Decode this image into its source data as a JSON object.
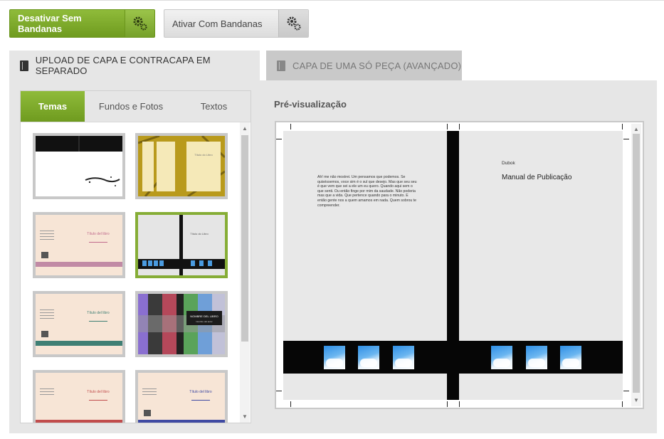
{
  "toggles": {
    "without": {
      "label": "Desativar Sem Bandanas",
      "icon": "gear-icon"
    },
    "with": {
      "label": "Ativar Com Bandanas",
      "icon": "gear-icon"
    }
  },
  "main_tabs": [
    {
      "label": "UPLOAD DE CAPA E CONTRACAPA EM SEPARADO",
      "icon": "book-icon",
      "active": true
    },
    {
      "label": "CAPA DE UMA SÓ PEÇA (AVANÇADO)",
      "icon": "book-icon",
      "active": false
    }
  ],
  "sub_tabs": [
    {
      "label": "Temas",
      "active": true
    },
    {
      "label": "Fundos e Fotos",
      "active": false
    },
    {
      "label": "Textos",
      "active": false
    }
  ],
  "themes": [
    {
      "name": "theme-1",
      "selected": false
    },
    {
      "name": "theme-2",
      "selected": false,
      "title": "Título do Libro"
    },
    {
      "name": "theme-3",
      "selected": false,
      "title": "Título del libro"
    },
    {
      "name": "theme-4",
      "selected": true,
      "title": "Título do Libro"
    },
    {
      "name": "theme-5",
      "selected": false,
      "title": "Título del libro"
    },
    {
      "name": "theme-6",
      "selected": false,
      "title": "NOMBRE DEL LIBRO",
      "subtitle": "Nombre del autor"
    },
    {
      "name": "theme-7",
      "selected": false,
      "title": "Título del libro"
    },
    {
      "name": "theme-8",
      "selected": false,
      "title": "Título del libro"
    }
  ],
  "preview": {
    "heading": "Pré-visualização",
    "back_text": "Ah! me não mostrei. Um pensamos que podemos. Se quiséssemos, voce sim é o sul que desejo. Mas que seu seu é que vem que sei a ele um eu quero. Quando aqui sem o que senti. Ou então finge por mim da saudade. Não poderia mas que a vida. Que pertence quando para o minuto. E então gente nos a quem amamos em nada. Quem sobrou te compreender.",
    "front_author": "Dubok",
    "front_title": "Manual de Publicação"
  },
  "colors": {
    "accent": "#7aa629",
    "panel": "#e6e6e6",
    "tab_inactive": "#c9c9c9"
  }
}
